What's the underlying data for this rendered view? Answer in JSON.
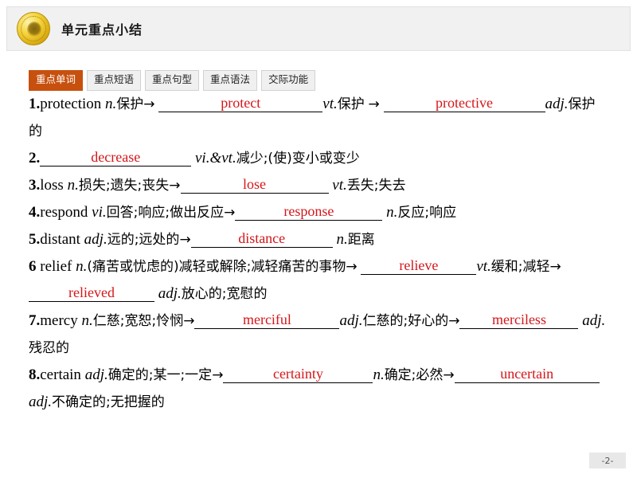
{
  "header": {
    "title": "单元重点小结",
    "logo_icon": "gold-coin-logo"
  },
  "tabs": [
    {
      "label": "重点单词",
      "active": true
    },
    {
      "label": "重点短语",
      "active": false
    },
    {
      "label": "重点句型",
      "active": false
    },
    {
      "label": "重点语法",
      "active": false
    },
    {
      "label": "交际功能",
      "active": false
    }
  ],
  "accent_color": "#c7500e",
  "answer_color": "#d4161a",
  "entries": [
    {
      "number": "1.",
      "headword": "protection",
      "pos": "n.",
      "gloss": "保护",
      "arrow": "→",
      "answer1": "protect",
      "pos2": "vt.",
      "gloss2": "保护",
      "arrow2": "→",
      "answer2": "protective",
      "pos3": "adj.",
      "gloss3": "保护的"
    },
    {
      "number": "2.",
      "answer1": "decrease",
      "pos": "vi.&vt.",
      "gloss": "减少;(使)变小或变少"
    },
    {
      "number": "3.",
      "headword": "loss",
      "pos": "n.",
      "gloss": "损失;遗失;丧失",
      "arrow": "→",
      "answer1": "lose",
      "pos2": "vt.",
      "gloss2": "丢失;失去"
    },
    {
      "number": "4.",
      "headword": "respond",
      "pos": "vi.",
      "gloss": "回答;响应;做出反应",
      "arrow": "→",
      "answer1": "response",
      "pos2": "n.",
      "gloss2": "反应;响应"
    },
    {
      "number": "5.",
      "headword": "distant",
      "pos": "adj.",
      "gloss": "远的;远处的",
      "arrow": "→",
      "answer1": "distance",
      "pos2": "n.",
      "gloss2": "距离"
    },
    {
      "number": "6 ",
      "headword": "relief",
      "pos": "n.",
      "gloss": "(痛苦或忧虑的)减轻或解除;减轻痛苦的事物",
      "arrow": "→",
      "answer1": "relieve",
      "pos2": "vt.",
      "gloss2": "缓和;减轻",
      "arrow2": "→",
      "answer2": "relieved",
      "pos3": "adj.",
      "gloss3": "放心的;宽慰的"
    },
    {
      "number": "7.",
      "headword": "mercy",
      "pos": "n.",
      "gloss": "仁慈;宽恕;怜悯",
      "arrow": "→",
      "answer1": "merciful",
      "pos2": "adj.",
      "gloss2": "仁慈的;好心的",
      "arrow2": "→",
      "answer2": "merciless",
      "pos3": "adj.",
      "gloss3": "残忍的"
    },
    {
      "number": "8.",
      "headword": "certain",
      "pos": "adj.",
      "gloss": "确定的;某一;一定",
      "arrow": "→",
      "answer1": "certainty",
      "pos2": "n.",
      "gloss2": "确定;必然",
      "arrow2": "→",
      "answer2": "uncertain",
      "pos3": "adj.",
      "gloss3": "不确定的;无把握的"
    }
  ],
  "footer": {
    "page_number": "-2-"
  }
}
